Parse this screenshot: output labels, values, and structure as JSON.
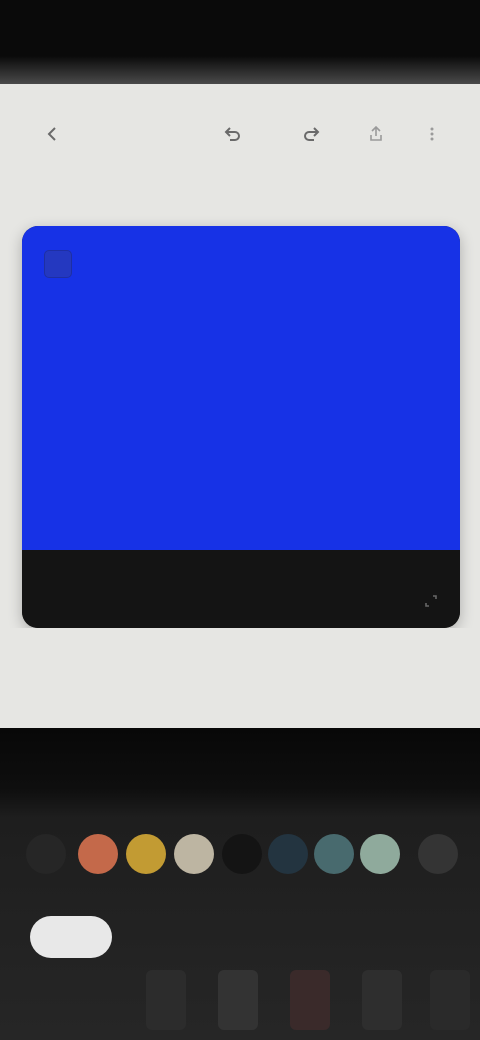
{
  "status_bar": {
    "time": ""
  },
  "toolbar": {
    "icons": [
      "back-icon",
      "undo-icon",
      "redo-icon",
      "share-icon",
      "more-icon"
    ]
  },
  "preview": {
    "title": "",
    "subtitle": "",
    "background_color": "#1732e6",
    "footer_color": "#141414"
  },
  "palette": {
    "swatches": [
      "#262626",
      "#c4694a",
      "#c29b33",
      "#bdb5a2",
      "#141414",
      "#233440",
      "#486a6e",
      "#8faa9c",
      "#343434"
    ]
  },
  "tools": {
    "selected_label": ""
  }
}
